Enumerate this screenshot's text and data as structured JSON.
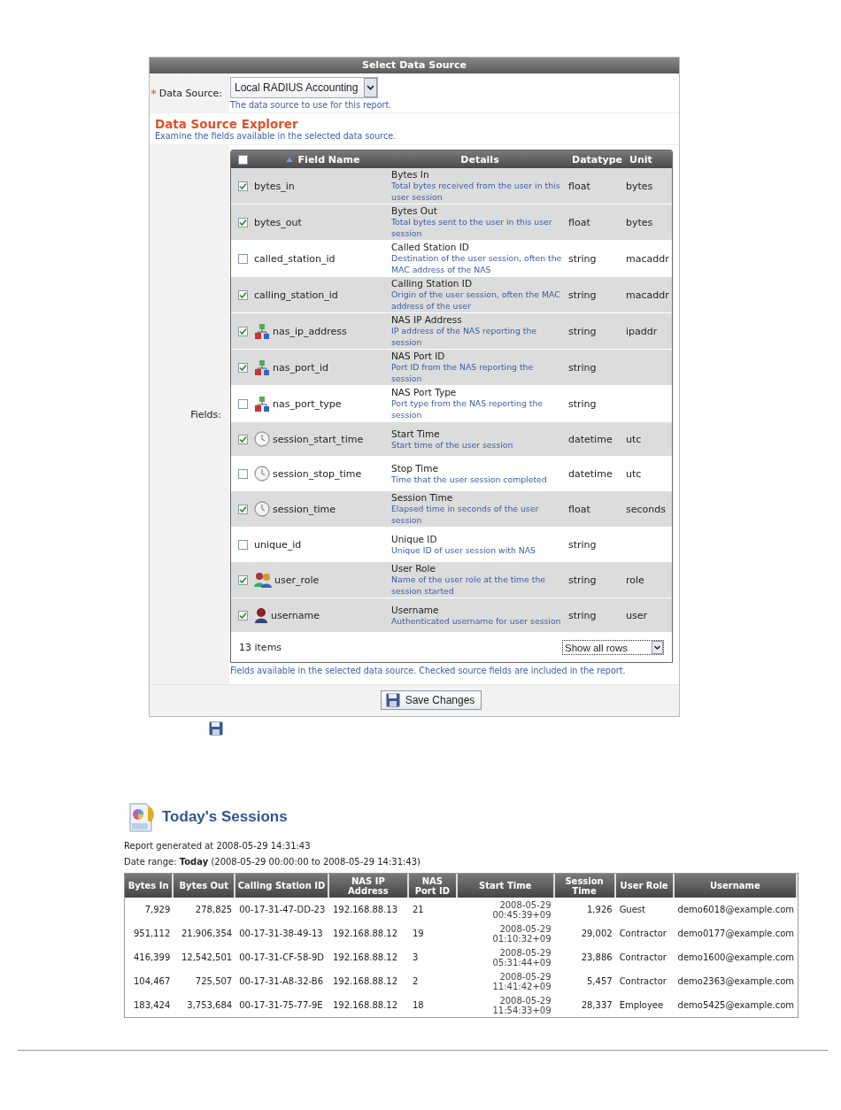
{
  "panel": {
    "title": "Select Data Source",
    "data_source": {
      "required_mark": "*",
      "label": "Data Source:",
      "value": "Local RADIUS Accounting",
      "hint": "The data source to use for this report."
    },
    "explorer": {
      "title": "Data Source Explorer",
      "subtitle": "Examine the fields available in the selected data source."
    },
    "fields": {
      "label": "Fields:",
      "all_checked": false,
      "columns": [
        {
          "label": "Field Name",
          "sorted": true
        },
        {
          "label": "Details",
          "sorted": false
        },
        {
          "label": "Datatype",
          "sorted": false
        },
        {
          "label": "Unit",
          "sorted": false
        }
      ],
      "rows": [
        {
          "checked": true,
          "kind": "plain",
          "name": "bytes_in",
          "title": "Bytes In",
          "description": "Total bytes received from the user in this user session",
          "datatype": "float",
          "unit": "bytes"
        },
        {
          "checked": true,
          "kind": "plain",
          "name": "bytes_out",
          "title": "Bytes Out",
          "description": "Total bytes sent to the user in this user session",
          "datatype": "float",
          "unit": "bytes"
        },
        {
          "checked": false,
          "kind": "plain",
          "name": "called_station_id",
          "title": "Called Station ID",
          "description": "Destination of the user session, often the MAC address of the NAS",
          "datatype": "string",
          "unit": "macaddr"
        },
        {
          "checked": true,
          "kind": "plain",
          "name": "calling_station_id",
          "title": "Calling Station ID",
          "description": "Origin of the user session, often the MAC address of the user",
          "datatype": "string",
          "unit": "macaddr"
        },
        {
          "checked": true,
          "kind": "network",
          "name": "nas_ip_address",
          "title": "NAS IP Address",
          "description": "IP address of the NAS reporting the session",
          "datatype": "string",
          "unit": "ipaddr"
        },
        {
          "checked": true,
          "kind": "network",
          "name": "nas_port_id",
          "title": "NAS Port ID",
          "description": "Port ID from the NAS reporting the session",
          "datatype": "string"
        },
        {
          "checked": false,
          "kind": "network",
          "name": "nas_port_type",
          "title": "NAS Port Type",
          "description": "Port type from the NAS reporting the session",
          "datatype": "string"
        },
        {
          "checked": true,
          "kind": "time",
          "name": "session_start_time",
          "title": "Start Time",
          "description": "Start time of the user session",
          "datatype": "datetime",
          "unit": "utc"
        },
        {
          "checked": false,
          "kind": "time",
          "name": "session_stop_time",
          "title": "Stop Time",
          "description": "Time that the user session completed",
          "datatype": "datetime",
          "unit": "utc"
        },
        {
          "checked": true,
          "kind": "time",
          "name": "session_time",
          "title": "Session Time",
          "description": "Elapsed time in seconds of the user session",
          "datatype": "float",
          "unit": "seconds"
        },
        {
          "checked": false,
          "kind": "plain",
          "name": "unique_id",
          "title": "Unique ID",
          "description": "Unique ID of user session with NAS",
          "datatype": "string"
        },
        {
          "checked": true,
          "kind": "role",
          "name": "user_role",
          "title": "User Role",
          "description": "Name of the user role at the time the session started",
          "datatype": "string",
          "unit": "role"
        },
        {
          "checked": true,
          "kind": "user",
          "name": "username",
          "title": "Username",
          "description": "Authenticated username for user session",
          "datatype": "string",
          "unit": "user"
        }
      ],
      "count": "13 items",
      "rows_select": "Show all rows",
      "caption": "Fields available in the selected data source. Checked source fields are included in the report."
    },
    "save_button": "Save Changes"
  },
  "report": {
    "title": "Today's Sessions",
    "generated": "Report generated at 2008-05-29 14:31:43",
    "date_range": "Date range: **Today** (2008-05-29 00:00:00 to 2008-05-29 14:31:43)",
    "table": {
      "columns": [
        "Bytes In",
        "Bytes Out",
        "Calling Station ID",
        "NAS IP Address",
        "NAS Port ID",
        "Start Time",
        "Session Time",
        "User Role",
        "Username"
      ],
      "rows": [
        [
          "7,929",
          "278,825",
          "00-17-31-47-DD-23",
          "192.168.88.13",
          "21",
          "2008-05-29 00:45:39+09",
          "1,926",
          "Guest",
          "demo6018@example.com"
        ],
        [
          "951,112",
          "21,906,354",
          "00-17-31-38-49-13",
          "192.168.88.12",
          "19",
          "2008-05-29 01:10:32+09",
          "29,002",
          "Contractor",
          "demo0177@example.com"
        ],
        [
          "416,399",
          "12,542,501",
          "00-17-31-CF-58-9D",
          "192.168.88.12",
          "3",
          "2008-05-29 05:31:44+09",
          "23,886",
          "Contractor",
          "demo1600@example.com"
        ],
        [
          "104,467",
          "725,507",
          "00-17-31-A8-32-B6",
          "192.168.88.12",
          "2",
          "2008-05-29 11:41:42+09",
          "5,457",
          "Contractor",
          "demo2363@example.com"
        ],
        [
          "183,424",
          "3,753,684",
          "00-17-31-75-77-9E",
          "192.168.88.12",
          "18",
          "2008-05-29 11:54:33+09",
          "28,337",
          "Employee",
          "demo5425@example.com"
        ]
      ]
    }
  }
}
